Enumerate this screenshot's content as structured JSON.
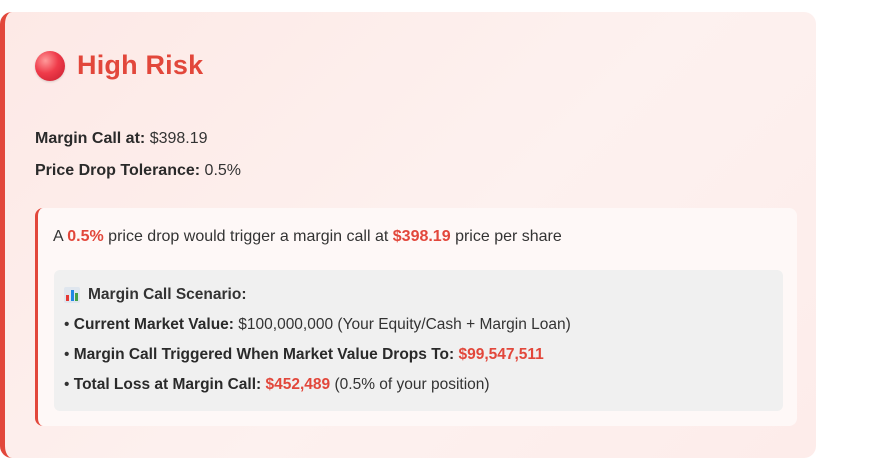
{
  "risk": {
    "level_label": "High Risk",
    "accent_color": "#e2473b",
    "icon": "red-circle-icon"
  },
  "summary": {
    "margin_call_label": "Margin Call at:",
    "margin_call_value": "$398.19",
    "tolerance_label": "Price Drop Tolerance:",
    "tolerance_value": "0.5%"
  },
  "explanation": {
    "prefix": "A",
    "drop_pct": "0.5%",
    "middle": "price drop would trigger a margin call at",
    "price": "$398.19",
    "suffix": "price per share"
  },
  "scenario": {
    "icon": "bar-chart-icon",
    "title": "Margin Call Scenario:",
    "bullet": "•",
    "market_value_label": "Current Market Value:",
    "market_value": "$100,000,000",
    "market_value_note": "(Your Equity/Cash + Margin Loan)",
    "trigger_label": "Margin Call Triggered When Market Value Drops To:",
    "trigger_value": "$99,547,511",
    "loss_label": "Total Loss at Margin Call:",
    "loss_value": "$452,489",
    "loss_note": "(0.5% of your position)"
  }
}
